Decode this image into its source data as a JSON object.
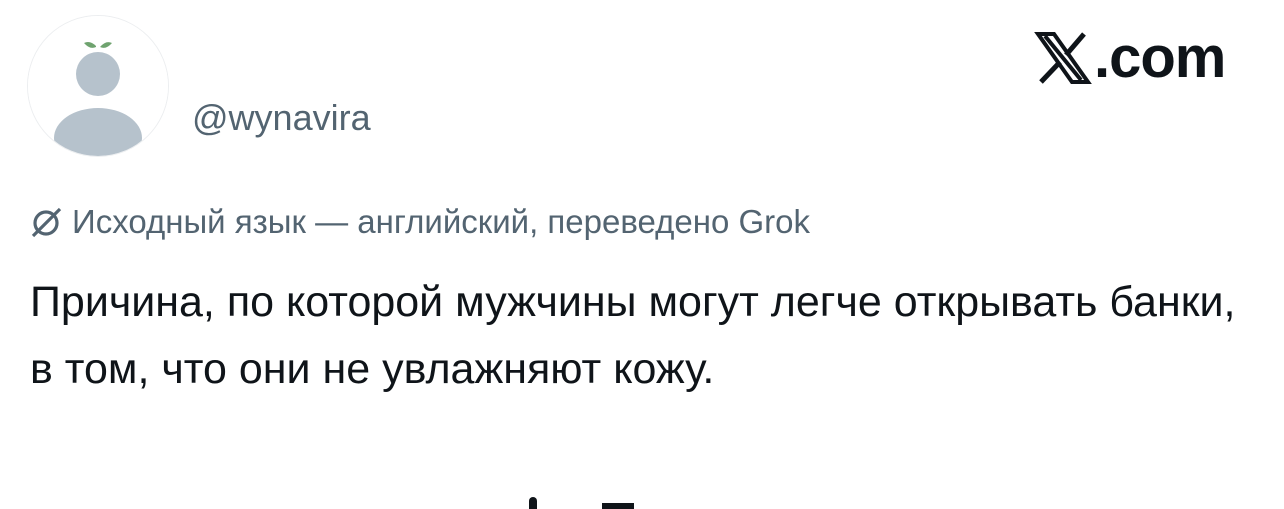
{
  "author": {
    "handle": "@wynavira",
    "avatar_icon": "default-profile-icon"
  },
  "brand": {
    "logo_icon": "x-logo-icon",
    "logo_text": ".com"
  },
  "translation_note": {
    "icon": "grok-icon",
    "text": "Исходный язык — английский, переведено Grok"
  },
  "tweet": {
    "text": "Причина, по которой мужчины могут легче открывать банки, в том, что они не увлажняют кожу."
  },
  "colors": {
    "text_primary": "#0f1419",
    "text_secondary": "#536471",
    "avatar_silhouette": "#b6c2cc"
  }
}
